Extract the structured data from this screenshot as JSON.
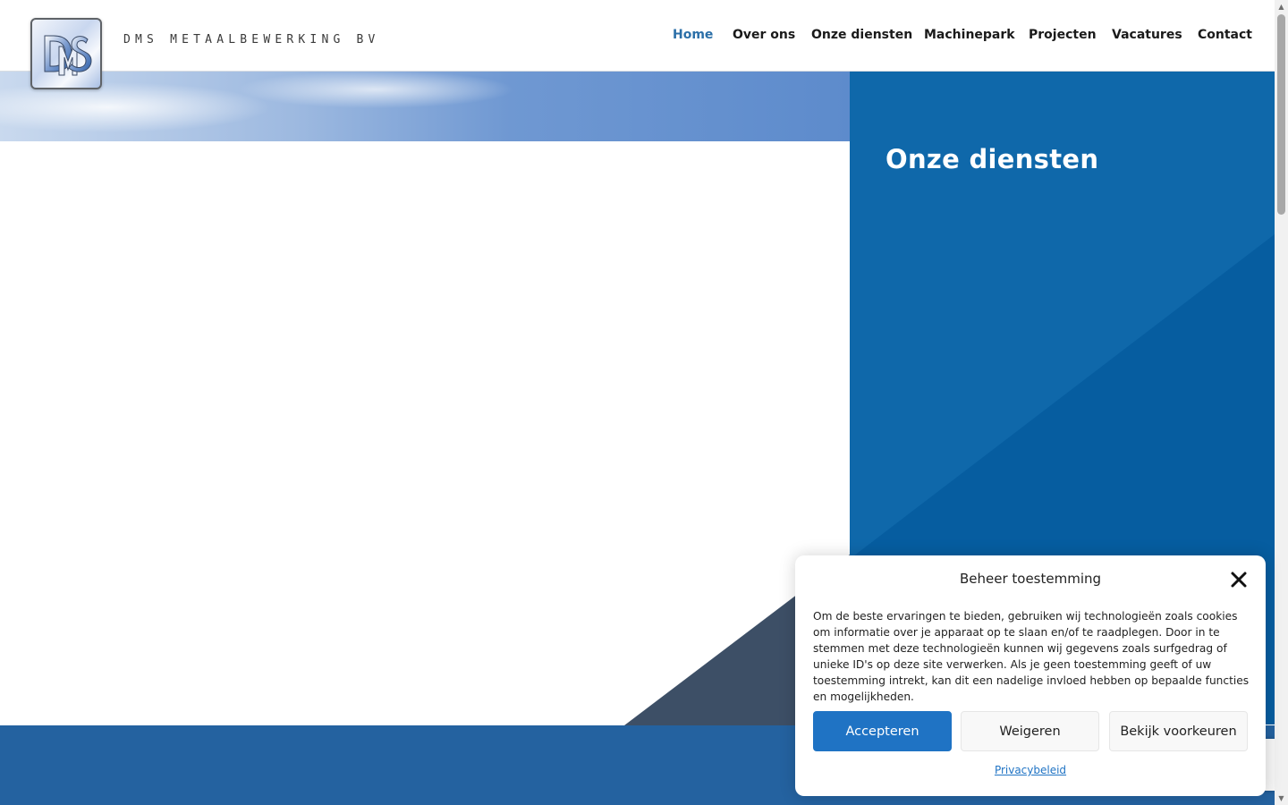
{
  "header": {
    "logo_text": "DMS METAALBEWERKING BV",
    "nav": [
      {
        "label": "Home",
        "active": true
      },
      {
        "label": "Over ons",
        "active": false
      },
      {
        "label": "Onze diensten",
        "active": false
      },
      {
        "label": "Machinepark",
        "active": false
      },
      {
        "label": "Projecten",
        "active": false
      },
      {
        "label": "Vacatures",
        "active": false
      },
      {
        "label": "Contact",
        "active": false
      }
    ]
  },
  "hero": {
    "panel_title": "Onze diensten"
  },
  "cookie": {
    "title": "Beheer toestemming",
    "body": "Om de beste ervaringen te bieden, gebruiken wij technologieën zoals cookies om informatie over je apparaat op te slaan en/of te raadplegen. Door in te stemmen met deze technologieën kunnen wij gegevens zoals surfgedrag of unieke ID's op deze site verwerken. Als je geen toestemming geeft of uw toestemming intrekt, kan dit een nadelige invloed hebben op bepaalde functies en mogelijkheden.",
    "accept_label": "Accepteren",
    "deny_label": "Weigeren",
    "prefs_label": "Bekijk voorkeuren",
    "privacy_link": "Privacybeleid"
  },
  "colors": {
    "nav_active": "#2b6fa8",
    "panel_blue": "#0f68aa",
    "footer_blue": "#2462a0",
    "accept_button": "#1f73c4",
    "dark_triangle": "#3d4f66"
  }
}
